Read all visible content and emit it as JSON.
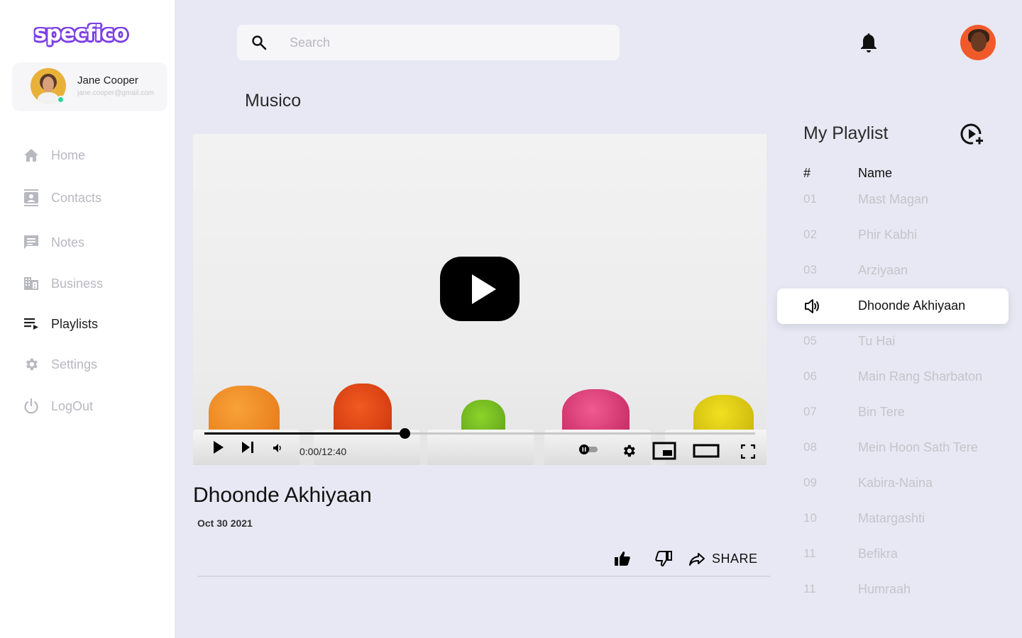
{
  "brand": {
    "logo_text": "specfico",
    "logo_color": "#7b3fe4"
  },
  "profile": {
    "name": "Jane Cooper",
    "email": "jane.cooper@gmail.com",
    "status_color": "#2fd49a"
  },
  "nav": {
    "items": [
      {
        "label": "Home",
        "icon": "home-icon"
      },
      {
        "label": "Contacts",
        "icon": "contacts-icon"
      },
      {
        "label": "Notes",
        "icon": "notes-icon"
      },
      {
        "label": "Business",
        "icon": "business-icon"
      },
      {
        "label": "Playlists",
        "icon": "playlist-icon",
        "active": true
      },
      {
        "label": "Settings",
        "icon": "gear-icon"
      },
      {
        "label": "LogOut",
        "icon": "power-icon"
      }
    ]
  },
  "search": {
    "placeholder": "Search",
    "value": ""
  },
  "section_title": "Musico",
  "player": {
    "current_time": "0:00",
    "duration": "12:40",
    "time_label": "0:00/12:40",
    "progress_fraction": 0.363
  },
  "video": {
    "title": "Dhoonde Akhiyaan",
    "date": "Oct 30 2021"
  },
  "actions": {
    "share_label": "SHARE"
  },
  "playlist": {
    "title": "My Playlist",
    "columns": {
      "num": "#",
      "name": "Name"
    },
    "active_index": 3,
    "items": [
      {
        "num": "01",
        "name": "Mast Magan"
      },
      {
        "num": "02",
        "name": "Phir Kabhi"
      },
      {
        "num": "03",
        "name": "Arziyaan"
      },
      {
        "num": "04",
        "name": "Dhoonde Akhiyaan"
      },
      {
        "num": "05",
        "name": "Tu Hai"
      },
      {
        "num": "06",
        "name": "Main Rang Sharbaton"
      },
      {
        "num": "07",
        "name": "Bin Tere"
      },
      {
        "num": "08",
        "name": "Mein Hoon Sath Tere"
      },
      {
        "num": "09",
        "name": "Kabira-Naina"
      },
      {
        "num": "10",
        "name": "Matargashti"
      },
      {
        "num": "11",
        "name": "Befikra"
      },
      {
        "num": "11",
        "name": "Humraah"
      }
    ]
  }
}
